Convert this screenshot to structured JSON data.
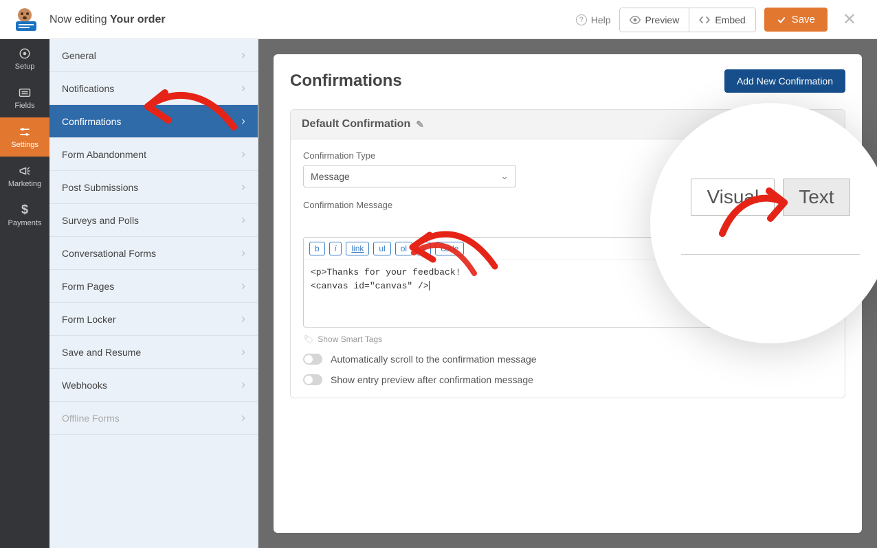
{
  "header": {
    "now_editing_label": "Now editing ",
    "form_name": "Your order",
    "help": "Help",
    "preview": "Preview",
    "embed": "Embed",
    "save": "Save"
  },
  "rail": [
    {
      "label": "Setup",
      "icon": "gear-icon"
    },
    {
      "label": "Fields",
      "icon": "list-icon"
    },
    {
      "label": "Settings",
      "icon": "sliders-icon"
    },
    {
      "label": "Marketing",
      "icon": "bullhorn-icon"
    },
    {
      "label": "Payments",
      "icon": "dollar-icon"
    }
  ],
  "rail_active_index": 2,
  "sidebar": [
    "General",
    "Notifications",
    "Confirmations",
    "Form Abandonment",
    "Post Submissions",
    "Surveys and Polls",
    "Conversational Forms",
    "Form Pages",
    "Form Locker",
    "Save and Resume",
    "Webhooks",
    "Offline Forms"
  ],
  "sidebar_active_index": 2,
  "sidebar_disabled_index": 11,
  "main": {
    "title": "Confirmations",
    "add_button": "Add New Confirmation",
    "card_title": "Default Confirmation",
    "type_label": "Confirmation Type",
    "type_value": "Message",
    "msg_label": "Confirmation Message",
    "tabs": {
      "visual": "Visual",
      "text": "Text"
    },
    "toolbar": [
      "b",
      "i",
      "link",
      "ul",
      "ol",
      "li",
      "code"
    ],
    "editor_line1": "<p>Thanks for your feedback!",
    "editor_line2": "<canvas id=\"canvas\" />",
    "smart_tags": "Show Smart Tags",
    "toggle_scroll": "Automatically scroll to the confirmation message",
    "toggle_preview": "Show entry preview after confirmation message"
  },
  "magnifier": {
    "visual": "Visual",
    "text": "Text"
  }
}
